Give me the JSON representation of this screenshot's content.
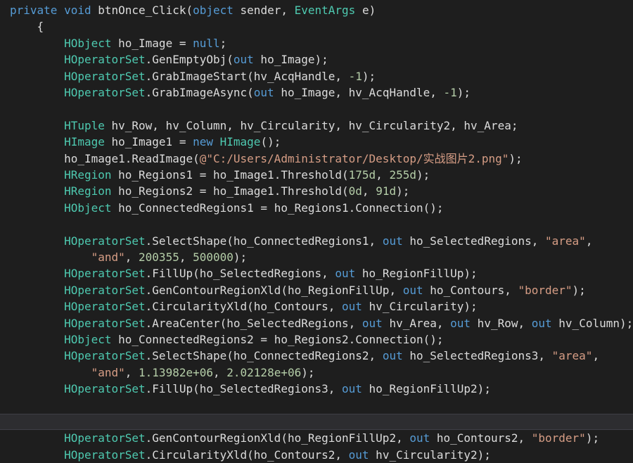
{
  "colors": {
    "background": "#1e1e1e",
    "keyword": "#569cd6",
    "type": "#4ec9b0",
    "string": "#d69d85",
    "number": "#b5cea8",
    "text": "#dcdcdc",
    "current_line": "#2d2d30"
  },
  "current_line_index": 24,
  "lines": [
    {
      "indent": "",
      "tokens": [
        [
          "kw",
          "private"
        ],
        [
          "tx",
          " "
        ],
        [
          "kw",
          "void"
        ],
        [
          "tx",
          " btnOnce_Click("
        ],
        [
          "kw",
          "object"
        ],
        [
          "tx",
          " sender, "
        ],
        [
          "ty",
          "EventArgs"
        ],
        [
          "tx",
          " e)"
        ]
      ]
    },
    {
      "indent": "    ",
      "tokens": [
        [
          "tx",
          "{"
        ]
      ]
    },
    {
      "indent": "        ",
      "tokens": [
        [
          "ty",
          "HObject"
        ],
        [
          "tx",
          " ho_Image = "
        ],
        [
          "kw",
          "null"
        ],
        [
          "tx",
          ";"
        ]
      ]
    },
    {
      "indent": "        ",
      "tokens": [
        [
          "ty",
          "HOperatorSet"
        ],
        [
          "tx",
          ".GenEmptyObj("
        ],
        [
          "kw",
          "out"
        ],
        [
          "tx",
          " ho_Image);"
        ]
      ]
    },
    {
      "indent": "        ",
      "tokens": [
        [
          "ty",
          "HOperatorSet"
        ],
        [
          "tx",
          ".GrabImageStart(hv_AcqHandle, "
        ],
        [
          "nm",
          "-1"
        ],
        [
          "tx",
          ");"
        ]
      ]
    },
    {
      "indent": "        ",
      "tokens": [
        [
          "ty",
          "HOperatorSet"
        ],
        [
          "tx",
          ".GrabImageAsync("
        ],
        [
          "kw",
          "out"
        ],
        [
          "tx",
          " ho_Image, hv_AcqHandle, "
        ],
        [
          "nm",
          "-1"
        ],
        [
          "tx",
          ");"
        ]
      ]
    },
    {
      "indent": "",
      "tokens": []
    },
    {
      "indent": "        ",
      "tokens": [
        [
          "ty",
          "HTuple"
        ],
        [
          "tx",
          " hv_Row, hv_Column, hv_Circularity, hv_Circularity2, hv_Area;"
        ]
      ]
    },
    {
      "indent": "        ",
      "tokens": [
        [
          "ty",
          "HImage"
        ],
        [
          "tx",
          " ho_Image1 = "
        ],
        [
          "kw",
          "new"
        ],
        [
          "tx",
          " "
        ],
        [
          "ty",
          "HImage"
        ],
        [
          "tx",
          "();"
        ]
      ]
    },
    {
      "indent": "        ",
      "tokens": [
        [
          "tx",
          "ho_Image1.ReadImage("
        ],
        [
          "st",
          "@\"C:/Users/Administrator/Desktop/实战图片2.png\""
        ],
        [
          "tx",
          ");"
        ]
      ]
    },
    {
      "indent": "        ",
      "tokens": [
        [
          "ty",
          "HRegion"
        ],
        [
          "tx",
          " ho_Regions1 = ho_Image1.Threshold("
        ],
        [
          "nm",
          "175d"
        ],
        [
          "tx",
          ", "
        ],
        [
          "nm",
          "255d"
        ],
        [
          "tx",
          ");"
        ]
      ]
    },
    {
      "indent": "        ",
      "tokens": [
        [
          "ty",
          "HRegion"
        ],
        [
          "tx",
          " ho_Regions2 = ho_Image1.Threshold("
        ],
        [
          "nm",
          "0d"
        ],
        [
          "tx",
          ", "
        ],
        [
          "nm",
          "91d"
        ],
        [
          "tx",
          ");"
        ]
      ]
    },
    {
      "indent": "        ",
      "tokens": [
        [
          "ty",
          "HObject"
        ],
        [
          "tx",
          " ho_ConnectedRegions1 = ho_Regions1.Connection();"
        ]
      ]
    },
    {
      "indent": "",
      "tokens": []
    },
    {
      "indent": "        ",
      "tokens": [
        [
          "ty",
          "HOperatorSet"
        ],
        [
          "tx",
          ".SelectShape(ho_ConnectedRegions1, "
        ],
        [
          "kw",
          "out"
        ],
        [
          "tx",
          " ho_SelectedRegions, "
        ],
        [
          "st",
          "\"area\""
        ],
        [
          "tx",
          ","
        ]
      ]
    },
    {
      "indent": "            ",
      "tokens": [
        [
          "st",
          "\"and\""
        ],
        [
          "tx",
          ", "
        ],
        [
          "nm",
          "200355"
        ],
        [
          "tx",
          ", "
        ],
        [
          "nm",
          "500000"
        ],
        [
          "tx",
          ");"
        ]
      ]
    },
    {
      "indent": "        ",
      "tokens": [
        [
          "ty",
          "HOperatorSet"
        ],
        [
          "tx",
          ".FillUp(ho_SelectedRegions, "
        ],
        [
          "kw",
          "out"
        ],
        [
          "tx",
          " ho_RegionFillUp);"
        ]
      ]
    },
    {
      "indent": "        ",
      "tokens": [
        [
          "ty",
          "HOperatorSet"
        ],
        [
          "tx",
          ".GenContourRegionXld(ho_RegionFillUp, "
        ],
        [
          "kw",
          "out"
        ],
        [
          "tx",
          " ho_Contours, "
        ],
        [
          "st",
          "\"border\""
        ],
        [
          "tx",
          ");"
        ]
      ]
    },
    {
      "indent": "        ",
      "tokens": [
        [
          "ty",
          "HOperatorSet"
        ],
        [
          "tx",
          ".CircularityXld(ho_Contours, "
        ],
        [
          "kw",
          "out"
        ],
        [
          "tx",
          " hv_Circularity);"
        ]
      ]
    },
    {
      "indent": "        ",
      "tokens": [
        [
          "ty",
          "HOperatorSet"
        ],
        [
          "tx",
          ".AreaCenter(ho_SelectedRegions, "
        ],
        [
          "kw",
          "out"
        ],
        [
          "tx",
          " hv_Area, "
        ],
        [
          "kw",
          "out"
        ],
        [
          "tx",
          " hv_Row, "
        ],
        [
          "kw",
          "out"
        ],
        [
          "tx",
          " hv_Column);"
        ]
      ]
    },
    {
      "indent": "        ",
      "tokens": [
        [
          "ty",
          "HObject"
        ],
        [
          "tx",
          " ho_ConnectedRegions2 = ho_Regions2.Connection();"
        ]
      ]
    },
    {
      "indent": "        ",
      "tokens": [
        [
          "ty",
          "HOperatorSet"
        ],
        [
          "tx",
          ".SelectShape(ho_ConnectedRegions2, "
        ],
        [
          "kw",
          "out"
        ],
        [
          "tx",
          " ho_SelectedRegions3, "
        ],
        [
          "st",
          "\"area\""
        ],
        [
          "tx",
          ","
        ]
      ]
    },
    {
      "indent": "            ",
      "tokens": [
        [
          "st",
          "\"and\""
        ],
        [
          "tx",
          ", "
        ],
        [
          "nm",
          "1.13982e+06"
        ],
        [
          "tx",
          ", "
        ],
        [
          "nm",
          "2.02128e+06"
        ],
        [
          "tx",
          ");"
        ]
      ]
    },
    {
      "indent": "        ",
      "tokens": [
        [
          "ty",
          "HOperatorSet"
        ],
        [
          "tx",
          ".FillUp(ho_SelectedRegions3, "
        ],
        [
          "kw",
          "out"
        ],
        [
          "tx",
          " ho_RegionFillUp2);"
        ]
      ]
    },
    {
      "indent": "",
      "tokens": []
    },
    {
      "indent": "",
      "tokens": []
    },
    {
      "indent": "        ",
      "tokens": [
        [
          "ty",
          "HOperatorSet"
        ],
        [
          "tx",
          ".GenContourRegionXld(ho_RegionFillUp2, "
        ],
        [
          "kw",
          "out"
        ],
        [
          "tx",
          " ho_Contours2, "
        ],
        [
          "st",
          "\"border\""
        ],
        [
          "tx",
          ");"
        ]
      ]
    },
    {
      "indent": "        ",
      "tokens": [
        [
          "ty",
          "HOperatorSet"
        ],
        [
          "tx",
          ".CircularityXld(ho_Contours2, "
        ],
        [
          "kw",
          "out"
        ],
        [
          "tx",
          " hv_Circularity2);"
        ]
      ]
    }
  ]
}
